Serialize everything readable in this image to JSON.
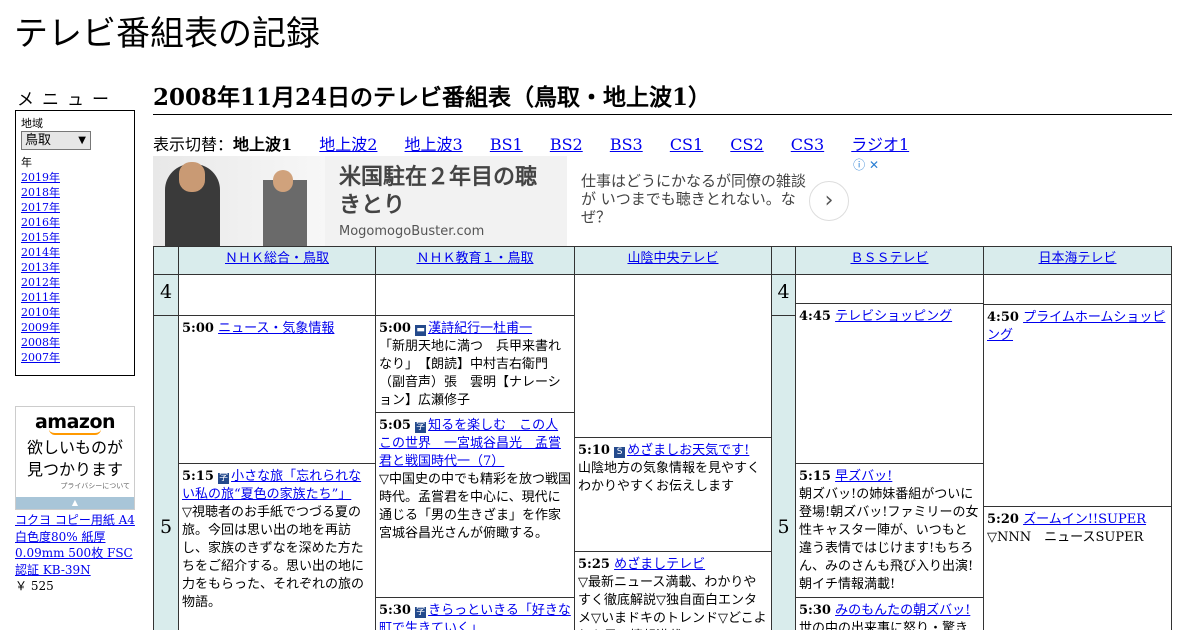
{
  "site_title": "テレビ番組表の記録",
  "menu": {
    "heading": "メニュー",
    "region_label": "地域",
    "region_value": "鳥取",
    "year_label": "年",
    "years": [
      "2019年",
      "2018年",
      "2017年",
      "2016年",
      "2015年",
      "2014年",
      "2013年",
      "2012年",
      "2011年",
      "2010年",
      "2009年",
      "2008年",
      "2007年"
    ]
  },
  "amazon_ad": {
    "logo": "amazon",
    "slogan_1": "欲しいものが",
    "slogan_2": "見つかります",
    "privacy": "プライバシーについて",
    "bar": "▲"
  },
  "product": {
    "name": "コクヨ コピー用紙 A4 白色度80% 紙厚 0.09mm 500枚 FSC認証 KB-39N",
    "price": "￥ 525"
  },
  "page_heading": "2008年11月24日のテレビ番組表（鳥取・地上波1）",
  "switcher": {
    "label": "表示切替：",
    "current": "地上波1",
    "links": [
      "地上波2",
      "地上波3",
      "BS1",
      "BS2",
      "BS3",
      "CS1",
      "CS2",
      "CS3",
      "ラジオ1"
    ]
  },
  "banner_ad": {
    "headline": "米国駐在２年目の聴きとり",
    "domain": "MogomogoBuster.com",
    "body": "仕事はどうにかなるが同僚の雑談が いつまでも聴きとれない。なぜ？",
    "next_symbol": "›",
    "adinfo": "ⓘ ✕"
  },
  "grid": {
    "headers": [
      "ＮＨＫ総合・鳥取",
      "ＮＨＫ教育１・鳥取",
      "山陰中央テレビ",
      "ＢＳＳテレビ",
      "日本海テレビ"
    ],
    "hours": [
      "4",
      "5"
    ],
    "programs": {
      "nhk_g_1": {
        "time": "5:00",
        "title": "ニュース・気象情報",
        "desc": ""
      },
      "nhk_g_2": {
        "time": "5:15",
        "icon": "字",
        "title": "小さな旅「忘れられない私の旅“夏色の家族たち”」",
        "desc": "▽視聴者のお手紙でつづる夏の旅。今回は思い出の地を再訪し、家族のきずなを深めた方たちをご紹介する。思い出の地に力をもらった、それぞれの旅の物語。"
      },
      "nhk_e_1": {
        "time": "5:00",
        "icon": "▬",
        "title": "漢詩紀行一杜甫一",
        "desc": "「新朋天地に満つ　兵甲来書れなり」　【朗読】中村吉右衛門　（副音声）張　雲明【ナレーション】広瀬修子"
      },
      "nhk_e_2": {
        "time": "5:05",
        "icon": "字",
        "title": "知るを楽しむ　この人この世界　一宮城谷昌光　孟嘗君と戦国時代一（7）",
        "desc": "▽中国史の中でも精彩を放つ戦国時代。孟嘗君を中心に、現代に通じる「男の生きざま」を作家宮城谷昌光さんが俯瞰する。"
      },
      "nhk_e_3": {
        "time": "5:30",
        "icon": "字",
        "title": "きらっといきる「好きな町で生きていく」",
        "desc": ""
      },
      "san_1": {
        "time": "5:10",
        "icon": "S",
        "title": "めざましお天気です!",
        "desc": "山陰地方の気象情報を見やすくわかりやすくお伝えします"
      },
      "san_2": {
        "time": "5:25",
        "title": "めざましテレビ",
        "desc": "▽最新ニュース満載、わかりやすく徹底解説▽独自面白エンタメ▽いまドキのトレンド▽どこよりも早い情報満載"
      },
      "bss_1": {
        "time": "4:45",
        "title": "テレビショッピング",
        "desc": ""
      },
      "bss_2": {
        "time": "5:15",
        "title": "早ズバッ!",
        "desc": "朝ズバッ!の姉妹番組がついに登場!朝ズバッ!ファミリーの女性キャスター陣が、いつもと違う表情ではじけます!もちろん、みのさんも飛び入り出演!朝イチ情報満載!"
      },
      "bss_3": {
        "time": "5:30",
        "title": "みのもんたの朝ズバッ!",
        "desc": "世の中の出来事に怒り・驚き"
      },
      "ntv_1": {
        "time": "4:50",
        "title": "プライムホームショッピング",
        "desc": ""
      },
      "ntv_2": {
        "time": "5:20",
        "title": "ズームイン!!SUPER",
        "desc": "▽NNN　ニュースSUPER"
      }
    }
  }
}
